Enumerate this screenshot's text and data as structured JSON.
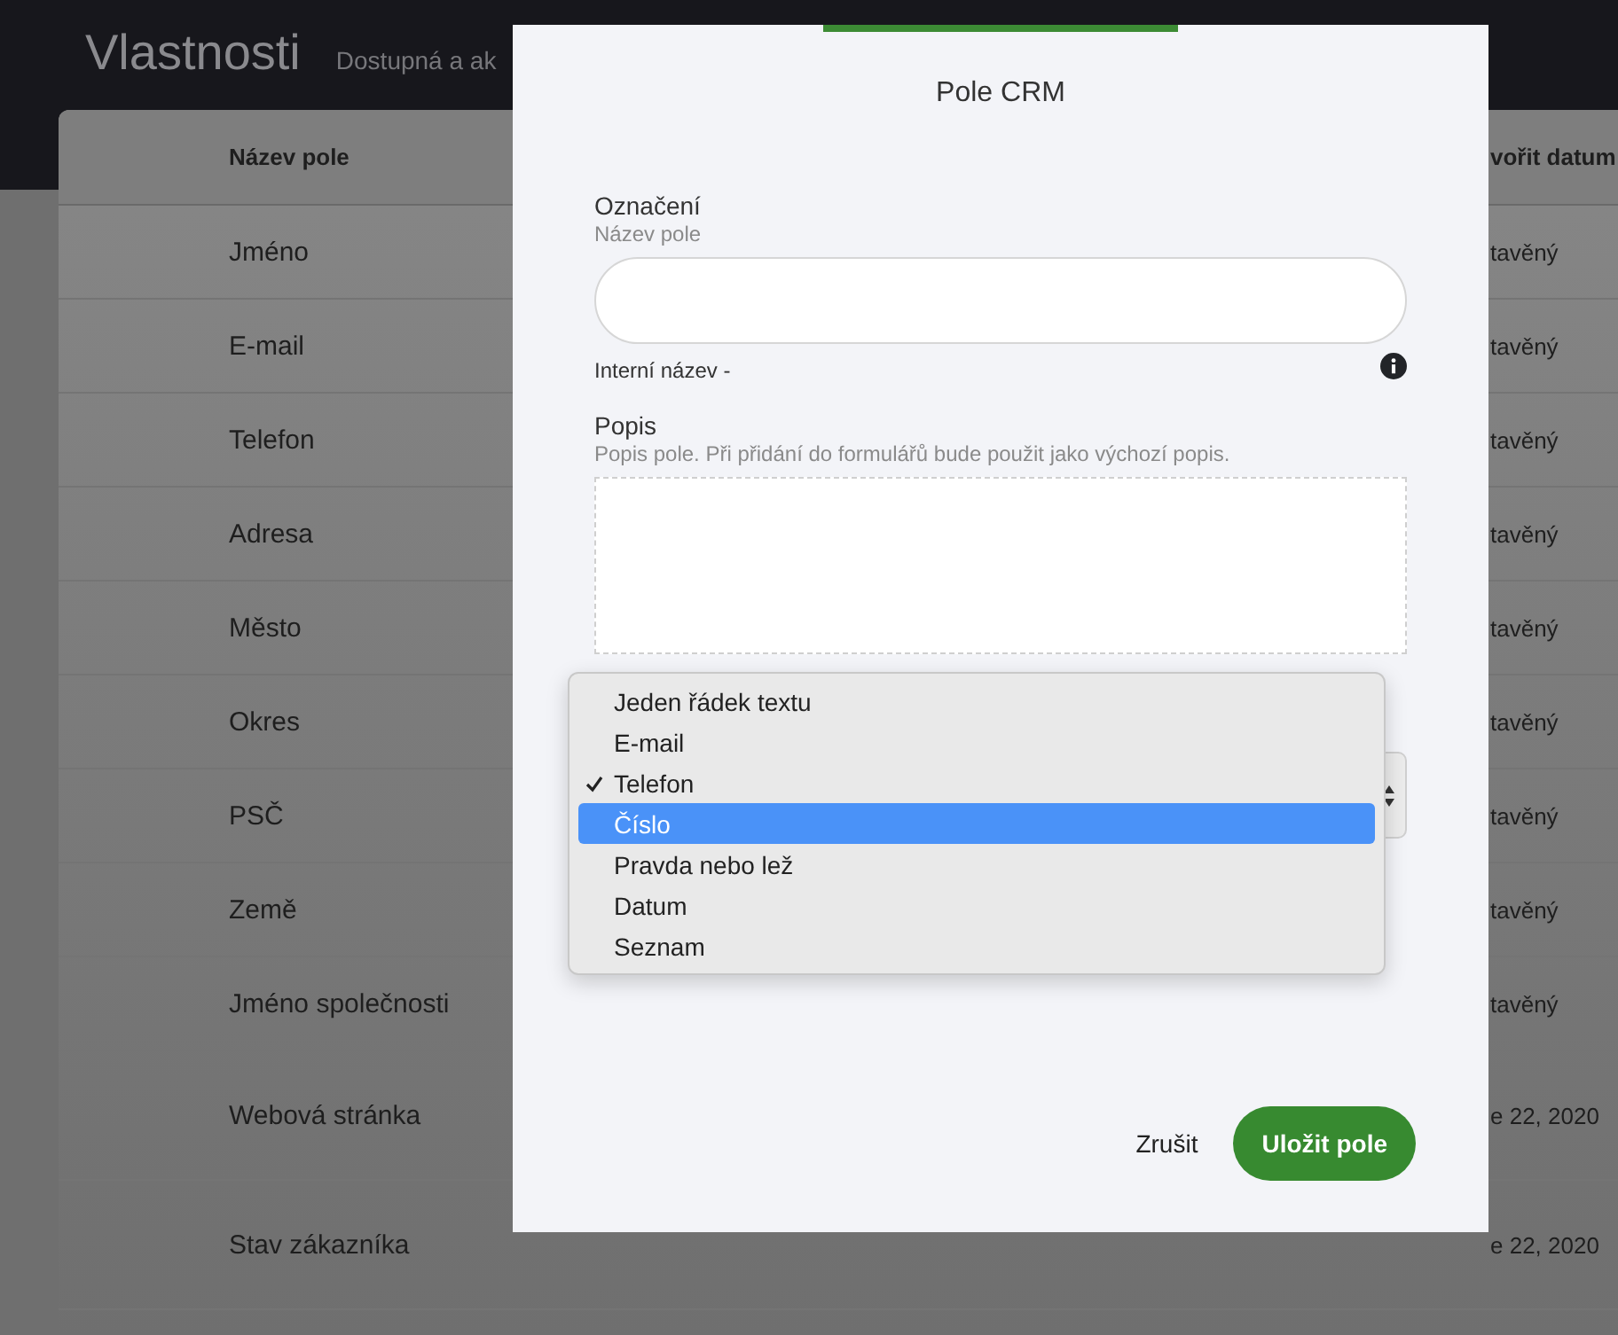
{
  "page": {
    "title": "Vlastnosti",
    "subtitle": "Dostupná a ak"
  },
  "table": {
    "columns": [
      "Název pole",
      "vořit datum"
    ],
    "rows": [
      {
        "name": "Jméno",
        "date": "tavěný",
        "tall": false
      },
      {
        "name": "E-mail",
        "date": "tavěný",
        "tall": false
      },
      {
        "name": "Telefon",
        "date": "tavěný",
        "tall": false
      },
      {
        "name": "Adresa",
        "date": "tavěný",
        "tall": false
      },
      {
        "name": "Město",
        "date": "tavěný",
        "tall": false
      },
      {
        "name": "Okres",
        "date": "tavěný",
        "tall": false
      },
      {
        "name": "PSČ",
        "date": "tavěný",
        "tall": false
      },
      {
        "name": "Země",
        "date": "tavěný",
        "tall": false
      },
      {
        "name": "Jméno společnosti",
        "date": "tavěný",
        "tall": false
      },
      {
        "name": "Webová stránka",
        "date": "e 22, 2020",
        "tall": true
      },
      {
        "name": "Stav zákazníka",
        "date": "e 22, 2020",
        "tall": true
      }
    ]
  },
  "dialog": {
    "title": "Pole CRM",
    "label_field": {
      "label": "Označení",
      "hint": "Název pole",
      "internal_name": "Interní název -"
    },
    "description_field": {
      "label": "Popis",
      "hint": "Popis pole. Při přidání do formulářů bude použit jako výchozí popis."
    },
    "type_menu": [
      {
        "label": "Jeden řádek textu",
        "checked": false,
        "selected": false
      },
      {
        "label": "E-mail",
        "checked": false,
        "selected": false
      },
      {
        "label": "Telefon",
        "checked": true,
        "selected": false
      },
      {
        "label": "Číslo",
        "checked": false,
        "selected": true
      },
      {
        "label": "Pravda nebo lež",
        "checked": false,
        "selected": false
      },
      {
        "label": "Datum",
        "checked": false,
        "selected": false
      },
      {
        "label": "Seznam",
        "checked": false,
        "selected": false
      }
    ],
    "buttons": {
      "cancel": "Zrušit",
      "save": "Uložit pole"
    }
  }
}
